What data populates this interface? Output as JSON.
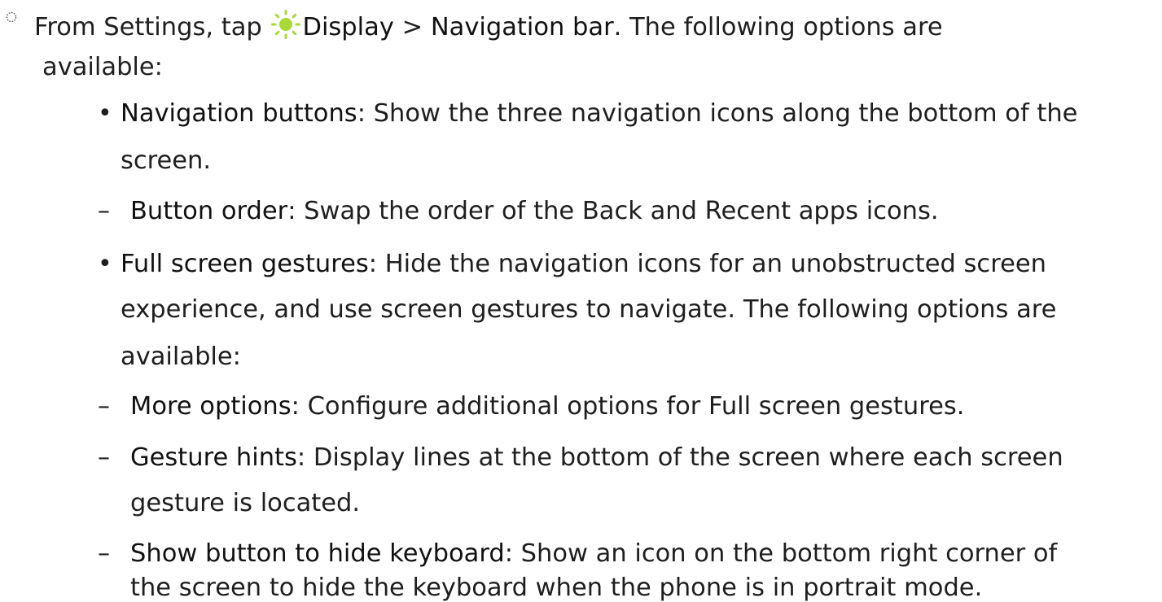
{
  "step": {
    "prefix": "From Settings, tap ",
    "display_label": "Display",
    "separator": " > ",
    "navbar_label": "Navigation bar",
    "suffix_line1": ". The following options are",
    "suffix_line2": "available:",
    "icon": "display-sun-icon"
  },
  "items": [
    {
      "label": "Navigation buttons",
      "text_line1": ": Show the three navigation icons along the bottom of the",
      "text_line2": "screen.",
      "subitems": [
        {
          "label": "Button order",
          "text_line1": ": Swap the order of the Back and Recent apps icons."
        }
      ]
    },
    {
      "label": "Full screen gestures",
      "text_line1": ": Hide the navigation icons for an unobstructed screen",
      "text_line2": "experience, and use screen gestures to navigate. The following options are",
      "text_line3": "available:",
      "subitems": [
        {
          "label": "More options",
          "text_line1": ": Configure additional options for Full screen gestures."
        },
        {
          "label": "Gesture hints",
          "text_line1": ": Display lines at the bottom of the screen where each screen",
          "text_line2": "gesture is located."
        },
        {
          "label": "Show button to hide keyboard",
          "text_line1": ": Show an icon on the bottom right corner of",
          "text_line2": "the screen to hide the keyboard when the phone is in portrait mode."
        }
      ]
    }
  ],
  "colors": {
    "text": "#1e1e1e",
    "sun_icon": "#a8d83a"
  },
  "markers": {
    "step_marker": "dotted-circle",
    "item_bullet": "•",
    "subitem_dash": "–"
  }
}
